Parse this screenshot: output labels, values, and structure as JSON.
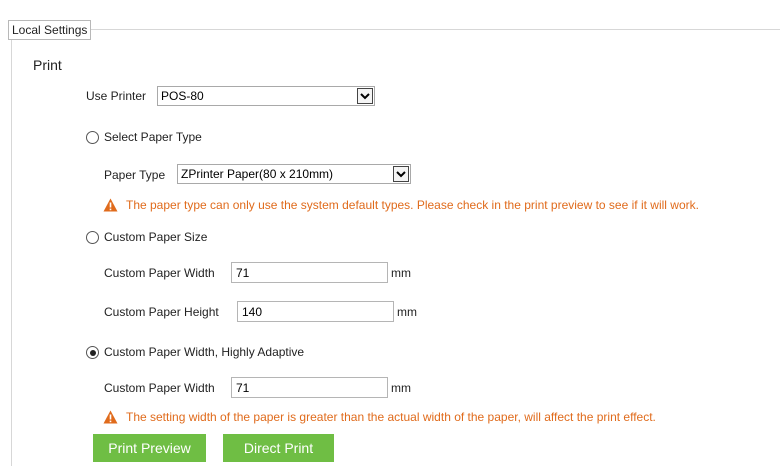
{
  "legend": "Local Settings",
  "section_title": "Print",
  "printer": {
    "label": "Use Printer",
    "value": "POS-80"
  },
  "paper_type_option": {
    "label": "Select Paper Type",
    "selected": false
  },
  "paper_type": {
    "label": "Paper Type",
    "value": "ZPrinter Paper(80 x 210mm)"
  },
  "warning1": "The paper type can only use the system default types. Please check in the print preview to see if it will work.",
  "custom_size_option": {
    "label": "Custom Paper Size",
    "selected": false
  },
  "custom_width": {
    "label": "Custom Paper Width",
    "value": "71",
    "unit": "mm"
  },
  "custom_height": {
    "label": "Custom Paper Height",
    "value": "140",
    "unit": "mm"
  },
  "adaptive_option": {
    "label": "Custom Paper Width, Highly Adaptive",
    "selected": true
  },
  "adaptive_width": {
    "label": "Custom Paper Width",
    "value": "71",
    "unit": "mm"
  },
  "warning2": "The setting width of the paper is greater than the actual width of the paper, will affect the print effect.",
  "buttons": {
    "preview": "Print Preview",
    "direct": "Direct Print"
  },
  "colors": {
    "accent_green": "#6fbe44",
    "warning_orange": "#e06b1c"
  }
}
